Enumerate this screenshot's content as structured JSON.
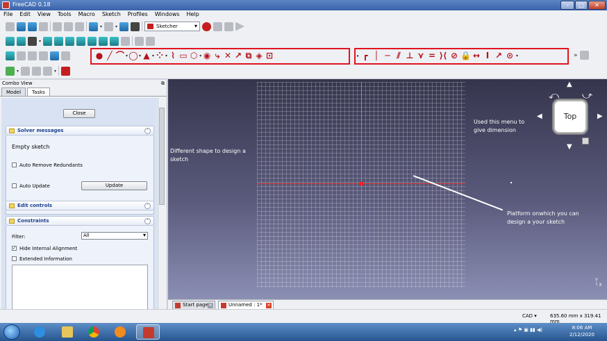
{
  "window": {
    "title": "FreeCAD 0.18",
    "min": "–",
    "max": "□",
    "close": "✕"
  },
  "menu": [
    "File",
    "Edit",
    "View",
    "Tools",
    "Macro",
    "Sketch",
    "Profiles",
    "Windows",
    "Help"
  ],
  "toolbar": {
    "workbench": "Sketcher",
    "more": "»"
  },
  "sketch_glyphs": [
    "●",
    "╱",
    "⌒",
    "◯",
    "▲",
    "⁘",
    "⌇",
    "▭",
    "⬡",
    "◉",
    "⤷",
    "✕",
    "↗",
    "⧉",
    "◈",
    "⊡"
  ],
  "constraint_glyphs": [
    "┏",
    "│",
    "─",
    "⫽",
    "⊥",
    "⋎",
    "=",
    "⟩⟨",
    "⊘",
    "🔒",
    "↔",
    "Ⅰ",
    "↗",
    "⊙"
  ],
  "combo": {
    "header": "Combo View",
    "pin": "⧉",
    "tabs": {
      "model": "Model",
      "tasks": "Tasks"
    },
    "close_button": "Close",
    "solver": {
      "title": "Solver messages",
      "message": "Empty sketch",
      "auto_remove": "Auto Remove Redundants",
      "auto_update": "Auto Update",
      "update_button": "Update"
    },
    "edit_controls": {
      "title": "Edit controls"
    },
    "constraints": {
      "title": "Constraints",
      "filter_label": "Filter:",
      "filter_value": "All",
      "hide_internal": "Hide Internal Alignment",
      "extended": "Extended Information"
    },
    "collapse": "⌃"
  },
  "annotations": {
    "shapes": "Different shape to design a sketch",
    "dimension": "Used this menu to give dimension",
    "platform": "Platform onwhich you can design a your sketch"
  },
  "navcube": {
    "face": "Top"
  },
  "doc_tabs": {
    "start": "Start page",
    "unnamed": "Unnamed : 1*"
  },
  "status": {
    "nav_style": "CAD ▾",
    "dimensions": "635.60 mm x 319.41 mm"
  },
  "taskbar": {
    "time": "8:06 AM",
    "date": "2/12/2020"
  },
  "colors": {
    "annotation_red": "#e0141e",
    "x_axis": "#e03a3a",
    "y_axis": "#3bd03b"
  }
}
